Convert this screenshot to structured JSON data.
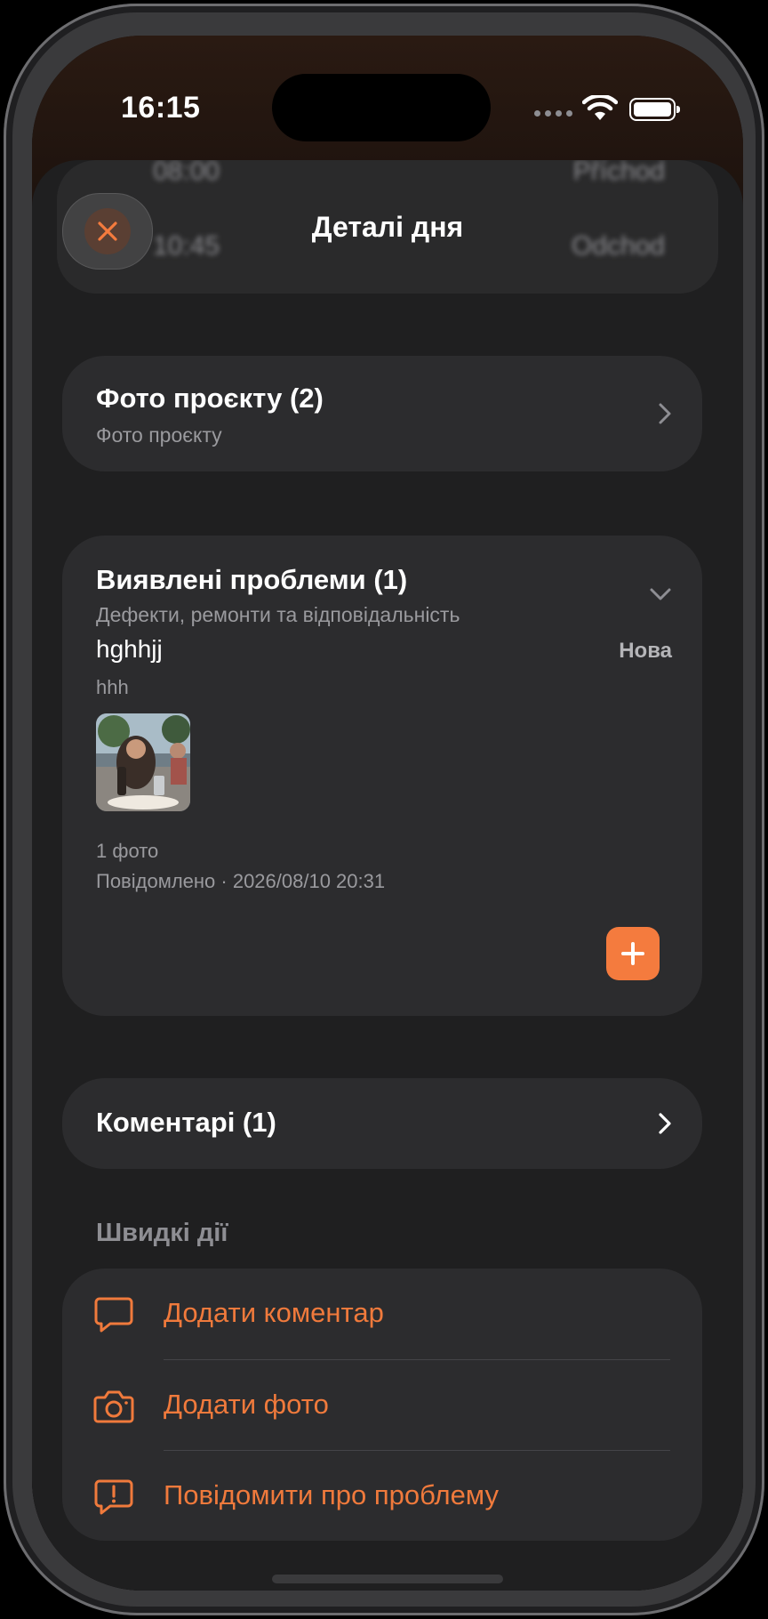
{
  "status_bar": {
    "time": "16:15"
  },
  "background": {
    "row1_time": "08:00",
    "row1_label": "Příchod",
    "row2_time": "10:45",
    "row2_label": "Odchod"
  },
  "header": {
    "title": "Деталі дня"
  },
  "photos_card": {
    "title": "Фото проєкту (2)",
    "subtitle": "Фото проєкту"
  },
  "issues_card": {
    "title": "Виявлені проблеми (1)",
    "subtitle": "Дефекти, ремонти та відповідальність",
    "issue": {
      "name": "hghhjj",
      "status": "Нова",
      "description": "hhh",
      "photo_count": "1 фото",
      "reported": "Повідомлено · 2026/08/10 20:31"
    }
  },
  "comments_card": {
    "title": "Коментарі (1)"
  },
  "quick_actions": {
    "label": "Швидкі дії",
    "items": [
      {
        "label": "Додати коментар",
        "icon": "chat-bubble-icon"
      },
      {
        "label": "Додати фото",
        "icon": "camera-icon"
      },
      {
        "label": "Повідомити про проблему",
        "icon": "alert-bubble-icon"
      }
    ]
  },
  "colors": {
    "accent": "#F47B3E",
    "card": "#2C2C2E",
    "sheet": "#1F1F20"
  }
}
